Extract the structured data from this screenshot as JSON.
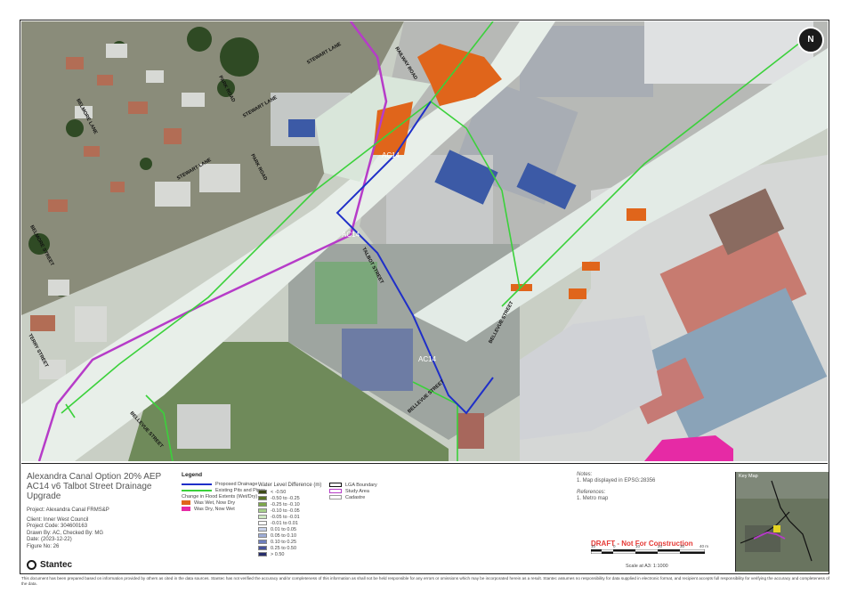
{
  "map": {
    "street_labels": {
      "railway_road": "RAILWAY ROAD",
      "stewart_lane_1": "STEWART LANE",
      "stewart_lane_2": "STEWART LANE",
      "stewart_lane_3": "STEWART LANE",
      "park_road_1": "PARK ROAD",
      "park_road_2": "PARK ROAD",
      "belmore_lane": "BELMORE LANE",
      "belmore_street": "BELMORE STREET",
      "talbot_street": "TALBOT STREET",
      "bellevue_street_1": "BELLEVUE STREET",
      "bellevue_street_2": "BELLEVUE STREET",
      "bellevue_street_3": "BELLEVUE STREET",
      "terry_street": "TERRY STREET"
    },
    "option_labels": [
      "AC14",
      "AC14",
      "AC14"
    ],
    "north_arrow": "N",
    "colors": {
      "proposed_drainage": "#1f2fc8",
      "existing_pits_pipes": "#3bd13b",
      "was_wet_now_dry": "#e0651b",
      "was_dry_now_wet": "#e62aa5",
      "study_area": "#b63cc8"
    }
  },
  "title_block": {
    "title_line1": "Alexandra Canal Option 20% AEP",
    "title_line2": "AC14 v6 Talbot Street Drainage",
    "title_line3": "Upgrade",
    "project": "Project: Alexandra Canal FRMS&P",
    "client": "Client:  Inner West Council",
    "project_code": "Project Code:  304600163",
    "drawn_by": "Drawn By:  AC, Checked By: MG",
    "date": "Date:  (2023-12-22)",
    "figure_no": "Figure No:  26",
    "logo": "Stantec"
  },
  "legend": {
    "title": "Legend",
    "proposed_drainage": "Proposed Drainage",
    "existing_pits_pipes": "Existing Pits and Pipes",
    "change_flood_extents": "Change in Flood Extents (Wet/Dry)",
    "was_wet_now_dry": "Was Wet, Now Dry",
    "was_dry_now_wet": "Was Dry, Now Wet",
    "wld_title": "Water Level Difference (m)",
    "wld_ranges": [
      {
        "label": "< -0.50",
        "color": "#3d4a16"
      },
      {
        "label": "-0.50 to -0.25",
        "color": "#5b7428"
      },
      {
        "label": "-0.25 to -0.10",
        "color": "#7da84a"
      },
      {
        "label": "-0.10 to -0.05",
        "color": "#a6cf8a"
      },
      {
        "label": "-0.05 to -0.01",
        "color": "#cfe8c2"
      },
      {
        "label": "-0.01 to 0.01",
        "color": "#ffffff"
      },
      {
        "label": "0.01 to 0.05",
        "color": "#c8d2ea"
      },
      {
        "label": "0.05 to 0.10",
        "color": "#9eadd7"
      },
      {
        "label": "0.10 to 0.25",
        "color": "#6e7fbd"
      },
      {
        "label": "0.25 to 0.50",
        "color": "#47539a"
      },
      {
        "label": "> 0.50",
        "color": "#262d6b"
      }
    ],
    "lga_boundary": "LGA Boundary",
    "study_area": "Study Area",
    "cadastre": "Cadastre"
  },
  "notes": {
    "notes_heading": "Notes:",
    "note1": "1. Map displayed in EPSG:28356",
    "refs_heading": "References:",
    "ref1": "1. Metro map"
  },
  "draft_label": "DRAFT - Not For Construction",
  "scale": {
    "ticks": [
      "10",
      "0",
      "10",
      "20",
      "30",
      "40 m"
    ],
    "note": "Scale at A3: 1:1000"
  },
  "keymap": {
    "label": "Key Map"
  },
  "disclaimer": "This document has been prepared based on information provided by others as cited in the data sources. Stantec has not verified the accuracy and/or completeness of this information as shall not be held responsible for any errors or omissions which may be incorporated herein as a result. Stantec assumes no responsibility for data supplied in electronic format, and recipient accepts full responsibility for verifying the accuracy and completeness of the data."
}
